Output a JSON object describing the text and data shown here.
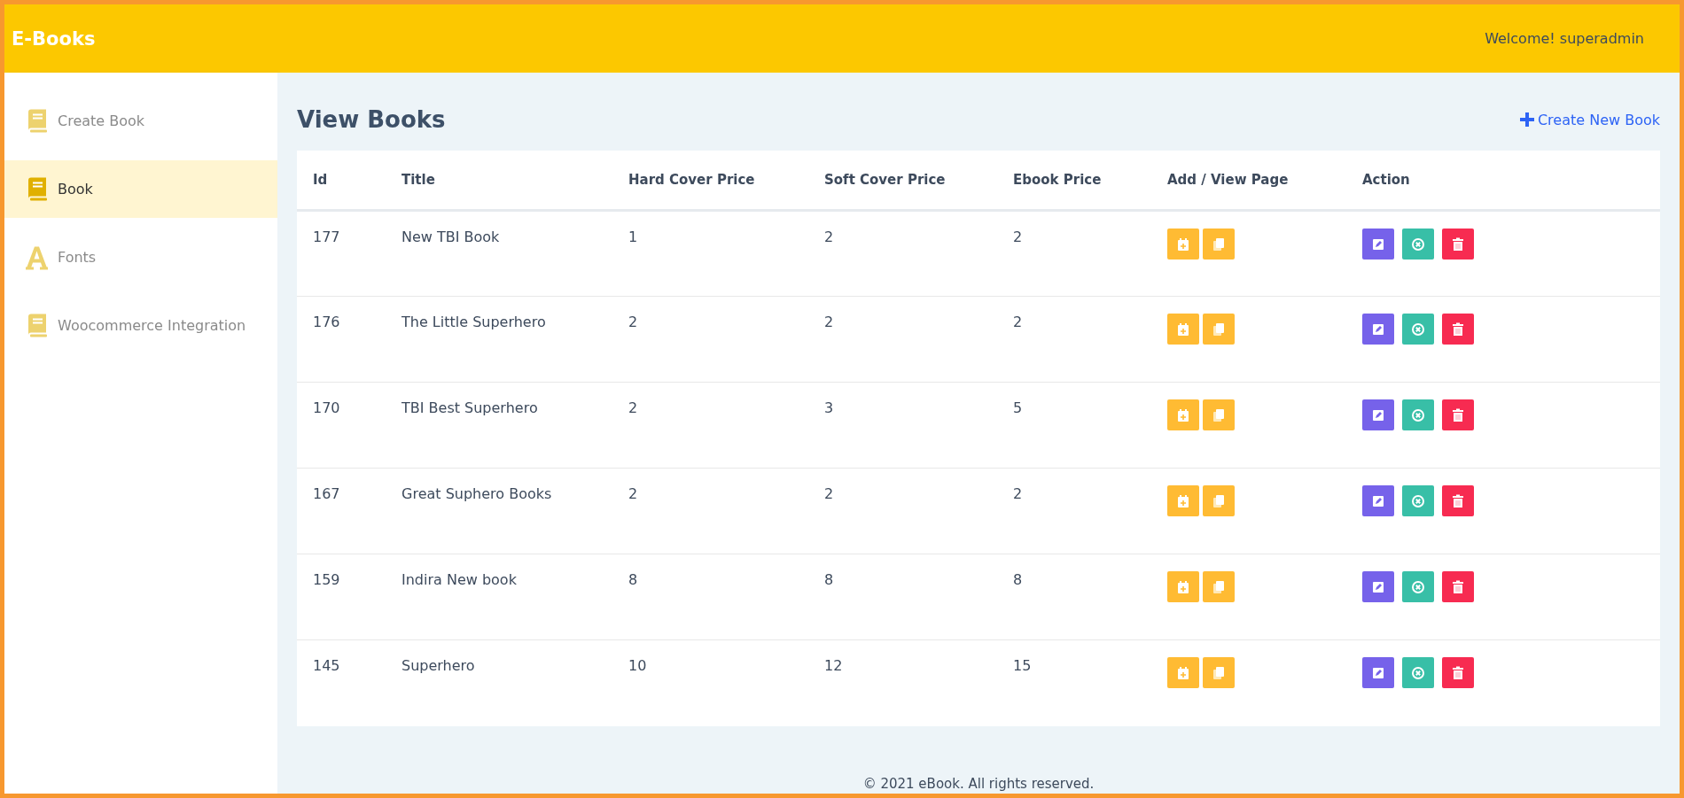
{
  "header": {
    "brand": "E-Books",
    "welcome": "Welcome! superadmin"
  },
  "sidebar": {
    "items": [
      {
        "label": "Create Book",
        "kind": "book",
        "selected": false
      },
      {
        "label": "Book",
        "kind": "book",
        "selected": true
      },
      {
        "label": "Fonts",
        "kind": "font",
        "selected": false
      },
      {
        "label": "Woocommerce Integration",
        "kind": "book",
        "selected": false
      }
    ]
  },
  "page": {
    "title": "View Books",
    "create_link": "Create New Book"
  },
  "table": {
    "columns": [
      "Id",
      "Title",
      "Hard Cover Price",
      "Soft Cover Price",
      "Ebook Price",
      "Add / View Page",
      "Action"
    ],
    "rows": [
      {
        "id": "177",
        "title": "New TBI Book",
        "hard_cover": "1",
        "soft_cover": "2",
        "ebook": "2"
      },
      {
        "id": "176",
        "title": "The Little Superhero",
        "hard_cover": "2",
        "soft_cover": "2",
        "ebook": "2"
      },
      {
        "id": "170",
        "title": "TBI Best Superhero",
        "hard_cover": "2",
        "soft_cover": "3",
        "ebook": "5"
      },
      {
        "id": "167",
        "title": "Great Suphero Books",
        "hard_cover": "2",
        "soft_cover": "2",
        "ebook": "2"
      },
      {
        "id": "159",
        "title": "Indira New book",
        "hard_cover": "8",
        "soft_cover": "8",
        "ebook": "8"
      },
      {
        "id": "145",
        "title": "Superhero",
        "hard_cover": "10",
        "soft_cover": "12",
        "ebook": "15"
      }
    ]
  },
  "footer": "© 2021 eBook. All rights reserved."
}
